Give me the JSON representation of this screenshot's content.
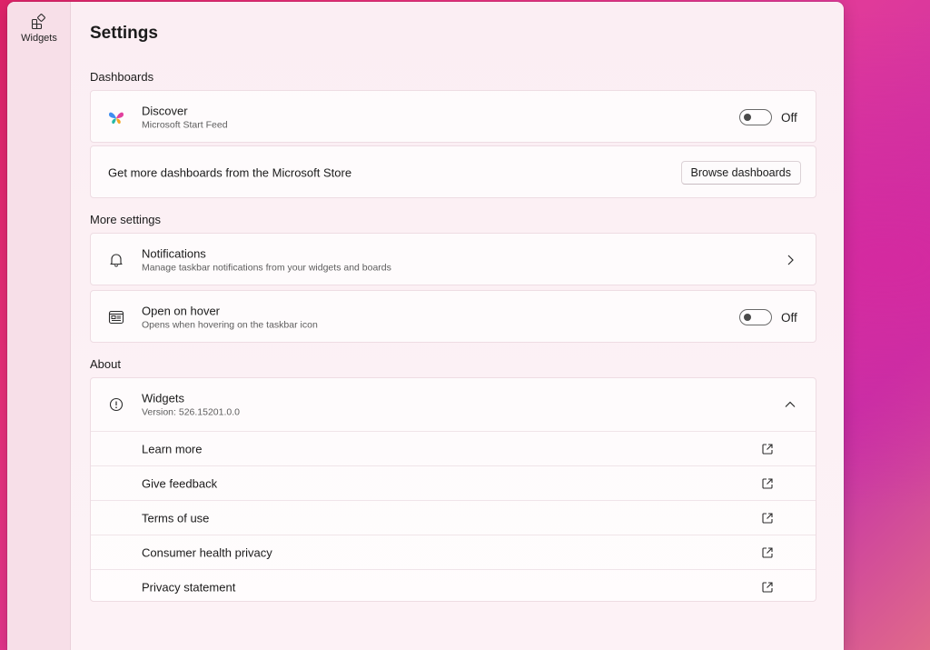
{
  "rail": {
    "items": [
      {
        "label": "Widgets",
        "icon": "widgets-icon"
      }
    ]
  },
  "page": {
    "title": "Settings"
  },
  "sections": {
    "dashboards": "Dashboards",
    "more_settings": "More settings",
    "about": "About"
  },
  "discover": {
    "title": "Discover",
    "subtitle": "Microsoft Start Feed",
    "toggle_state": "Off",
    "icon": "butterfly-icon"
  },
  "store": {
    "text": "Get more dashboards from the Microsoft Store",
    "button": "Browse dashboards"
  },
  "notifications": {
    "title": "Notifications",
    "subtitle": "Manage taskbar notifications from your widgets and boards",
    "icon": "bell-icon"
  },
  "hover": {
    "title": "Open on hover",
    "subtitle": "Opens when hovering on the taskbar icon",
    "toggle_state": "Off",
    "icon": "hover-panel-icon"
  },
  "about": {
    "title": "Widgets",
    "version": "Version: 526.15201.0.0",
    "icon": "info-icon",
    "links": [
      {
        "label": "Learn more"
      },
      {
        "label": "Give feedback"
      },
      {
        "label": "Terms of use"
      },
      {
        "label": "Consumer health privacy"
      },
      {
        "label": "Privacy statement"
      }
    ]
  },
  "colors": {
    "accent_pink": "#e0236a",
    "window_bg": "#fcf1f5",
    "rail_bg": "#f7dfe8"
  }
}
